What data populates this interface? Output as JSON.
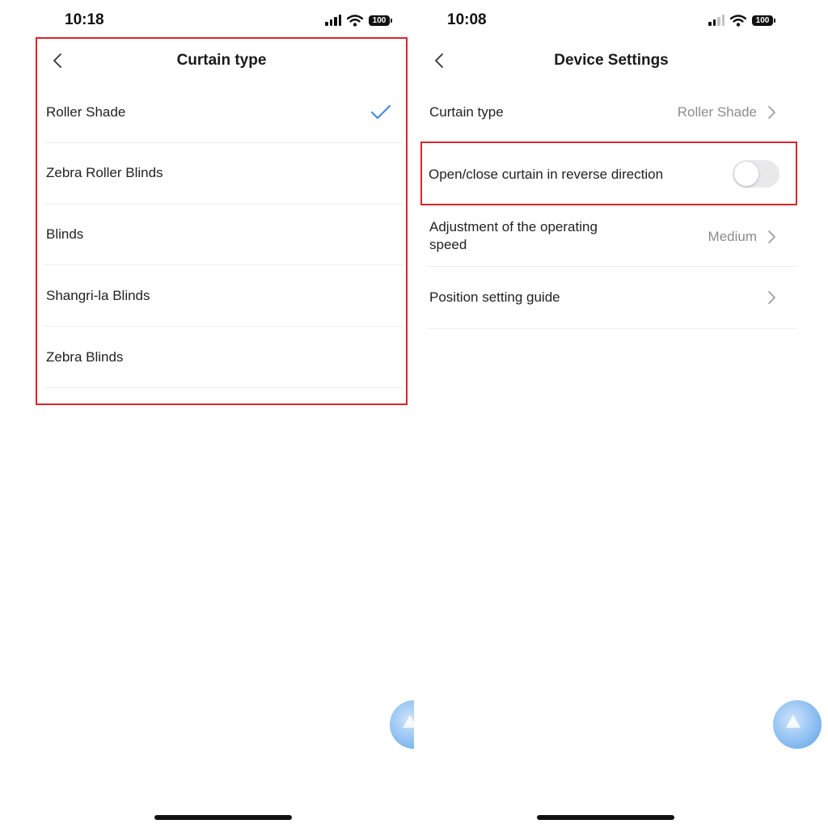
{
  "left_screen": {
    "status_bar": {
      "time": "10:18",
      "battery": "100"
    },
    "header": {
      "title": "Curtain type"
    },
    "options": [
      {
        "label": "Roller Shade",
        "selected": true
      },
      {
        "label": "Zebra Roller Blinds",
        "selected": false
      },
      {
        "label": "Blinds",
        "selected": false
      },
      {
        "label": "Shangri-la Blinds",
        "selected": false
      },
      {
        "label": "Zebra Blinds",
        "selected": false
      }
    ]
  },
  "right_screen": {
    "status_bar": {
      "time": "10:08",
      "battery": "100"
    },
    "header": {
      "title": "Device Settings"
    },
    "settings": {
      "curtain_type": {
        "label": "Curtain type",
        "value": "Roller Shade"
      },
      "reverse_direction": {
        "label": "Open/close curtain in reverse direction",
        "enabled": false
      },
      "operating_speed": {
        "label_line1": "Adjustment of the operating",
        "label_line2": "speed",
        "value": "Medium"
      },
      "position_guide": {
        "label": "Position setting guide"
      }
    }
  },
  "colors": {
    "accent_check": "#4a86e8",
    "highlight_border": "#d8262c",
    "secondary_text": "#8c8c8c",
    "toggle_off": "#e9e9eb"
  },
  "icons": [
    "back-chevron-icon",
    "checkmark-icon",
    "chevron-right-icon",
    "cellular-signal-icon",
    "wifi-icon",
    "battery-icon",
    "floating-assistant-icon"
  ]
}
